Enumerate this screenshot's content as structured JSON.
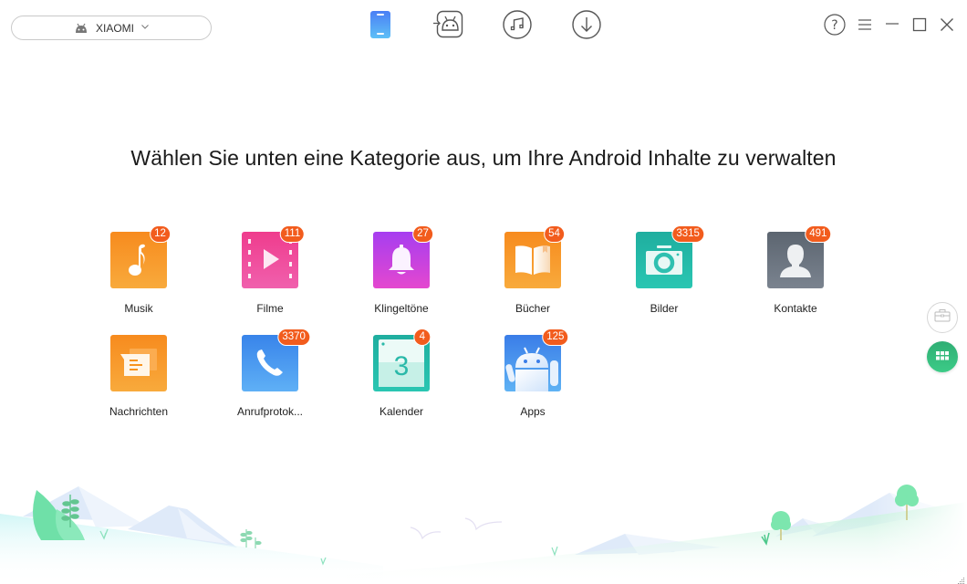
{
  "device": {
    "name": "XIAOMI",
    "icon": "android-icon",
    "dropdown_icon": "chevron-down-icon"
  },
  "nav": [
    {
      "name": "device-manager",
      "icon": "phone-icon",
      "active": true,
      "color": "#4a8cf7"
    },
    {
      "name": "android-mover",
      "icon": "android-transfer-icon",
      "active": false
    },
    {
      "name": "media-manager",
      "icon": "music-note-icon",
      "active": false
    },
    {
      "name": "downloader",
      "icon": "download-icon",
      "active": false
    }
  ],
  "window_controls": [
    "help-icon",
    "menu-icon",
    "minimize-icon",
    "maximize-icon",
    "close-icon"
  ],
  "headline": "Wählen Sie unten eine Kategorie aus, um Ihre Android Inhalte zu verwalten",
  "categories": [
    {
      "label": "Musik",
      "count": "12",
      "icon": "music-icon"
    },
    {
      "label": "Filme",
      "count": "111",
      "icon": "film-icon"
    },
    {
      "label": "Klingeltöne",
      "count": "27",
      "icon": "bell-icon"
    },
    {
      "label": "Bücher",
      "count": "54",
      "icon": "book-icon"
    },
    {
      "label": "Bilder",
      "count": "3315",
      "icon": "camera-icon"
    },
    {
      "label": "Kontakte",
      "count": "491",
      "icon": "contact-icon"
    },
    {
      "label": "Nachrichten",
      "count": "",
      "icon": "message-icon"
    },
    {
      "label": "Anrufprotok...",
      "count": "3370",
      "icon": "phone-call-icon"
    },
    {
      "label": "Kalender",
      "count": "4",
      "icon": "calendar-icon",
      "day": "3"
    },
    {
      "label": "Apps",
      "count": "125",
      "icon": "android-app-icon"
    }
  ],
  "side_buttons": [
    {
      "name": "toolbox",
      "icon": "briefcase-icon"
    },
    {
      "name": "category-view",
      "icon": "grid-icon",
      "active": true,
      "color": "#35bd7e"
    }
  ],
  "colors": {
    "badge": "#f25c1d",
    "accent_green": "#35bd7e",
    "accent_blue": "#4a8cf7"
  }
}
